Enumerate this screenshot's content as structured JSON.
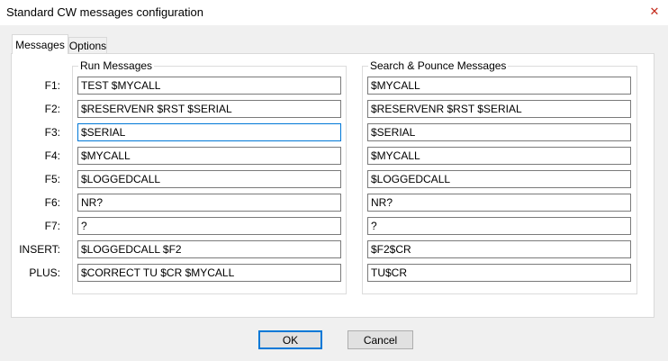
{
  "window": {
    "title": "Standard CW messages configuration",
    "close_glyph": "✕"
  },
  "tabs": [
    {
      "label": "Messages",
      "active": true
    },
    {
      "label": "Options",
      "active": false
    }
  ],
  "groups": {
    "run_title": "Run Messages",
    "sp_title": "Search & Pounce Messages"
  },
  "rows": [
    {
      "key": "F1:",
      "run": "TEST $MYCALL",
      "sp": "$MYCALL"
    },
    {
      "key": "F2:",
      "run": "$RESERVENR $RST $SERIAL",
      "sp": "$RESERVENR $RST $SERIAL"
    },
    {
      "key": "F3:",
      "run": "$SERIAL",
      "sp": "$SERIAL"
    },
    {
      "key": "F4:",
      "run": "$MYCALL",
      "sp": "$MYCALL"
    },
    {
      "key": "F5:",
      "run": "$LOGGEDCALL",
      "sp": "$LOGGEDCALL"
    },
    {
      "key": "F6:",
      "run": "NR?",
      "sp": "NR?"
    },
    {
      "key": "F7:",
      "run": "?",
      "sp": "?"
    },
    {
      "key": "INSERT:",
      "run": "$LOGGEDCALL $F2",
      "sp": "$F2$CR"
    },
    {
      "key": "PLUS:",
      "run": "$CORRECT TU $CR $MYCALL",
      "sp": "TU$CR"
    }
  ],
  "buttons": {
    "ok": "OK",
    "cancel": "Cancel"
  },
  "colors": {
    "focus_accent": "#0078d7",
    "close_icon": "#c42b1c"
  }
}
